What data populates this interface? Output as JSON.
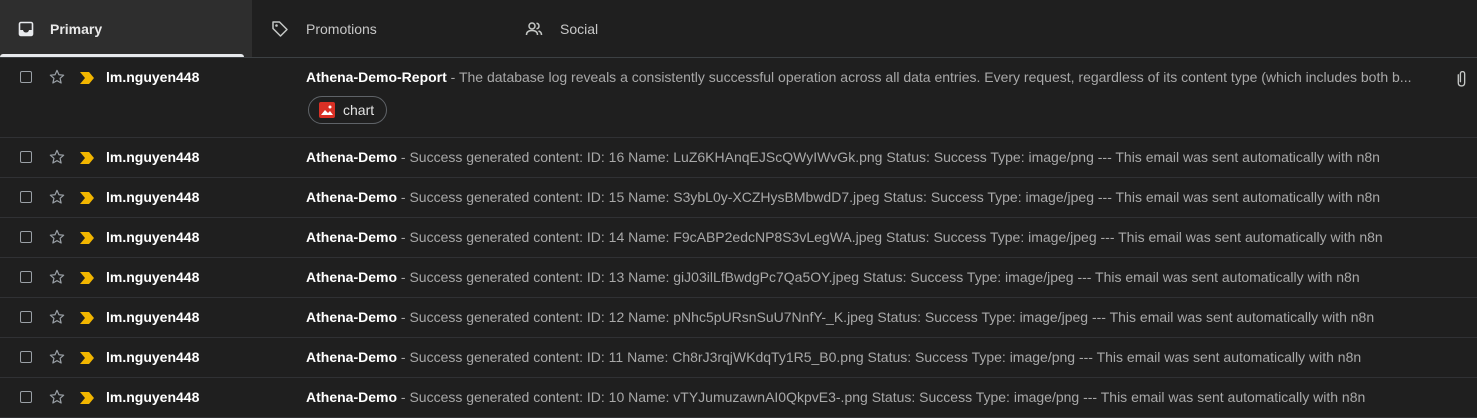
{
  "tabs": [
    {
      "label": "Primary",
      "icon": "inbox-icon",
      "active": true
    },
    {
      "label": "Promotions",
      "icon": "tag-icon",
      "active": false
    },
    {
      "label": "Social",
      "icon": "people-icon",
      "active": false
    }
  ],
  "colors": {
    "background": "#1f1f1f",
    "important_marker": "#f2b600",
    "attachment_icon": "#d93025"
  },
  "emails": [
    {
      "sender": "lm.nguyen448",
      "subject": "Athena-Demo-Report",
      "snippet": " - The database log reveals a consistently successful operation across all data entries. Every request, regardless of its content type (which includes both b...",
      "attachment": "chart"
    },
    {
      "sender": "lm.nguyen448",
      "subject": "Athena-Demo",
      "snippet": " - Success generated content: ID: 16 Name: LuZ6KHAnqEJScQWyIWvGk.png Status: Success Type: image/png --- This email was sent automatically with n8n"
    },
    {
      "sender": "lm.nguyen448",
      "subject": "Athena-Demo",
      "snippet": " - Success generated content: ID: 15 Name: S3ybL0y-XCZHysBMbwdD7.jpeg Status: Success Type: image/jpeg --- This email was sent automatically with n8n"
    },
    {
      "sender": "lm.nguyen448",
      "subject": "Athena-Demo",
      "snippet": " - Success generated content: ID: 14 Name: F9cABP2edcNP8S3vLegWA.jpeg Status: Success Type: image/jpeg --- This email was sent automatically with n8n"
    },
    {
      "sender": "lm.nguyen448",
      "subject": "Athena-Demo",
      "snippet": " - Success generated content: ID: 13 Name: giJ03ilLfBwdgPc7Qa5OY.jpeg Status: Success Type: image/jpeg --- This email was sent automatically with n8n"
    },
    {
      "sender": "lm.nguyen448",
      "subject": "Athena-Demo",
      "snippet": " - Success generated content: ID: 12 Name: pNhc5pURsnSuU7NnfY-_K.jpeg Status: Success Type: image/jpeg --- This email was sent automatically with n8n"
    },
    {
      "sender": "lm.nguyen448",
      "subject": "Athena-Demo",
      "snippet": " - Success generated content: ID: 11 Name: Ch8rJ3rqjWKdqTy1R5_B0.png Status: Success Type: image/png --- This email was sent automatically with n8n"
    },
    {
      "sender": "lm.nguyen448",
      "subject": "Athena-Demo",
      "snippet": " - Success generated content: ID: 10 Name: vTYJumuzawnAI0QkpvE3-.png Status: Success Type: image/png --- This email was sent automatically with n8n"
    }
  ]
}
